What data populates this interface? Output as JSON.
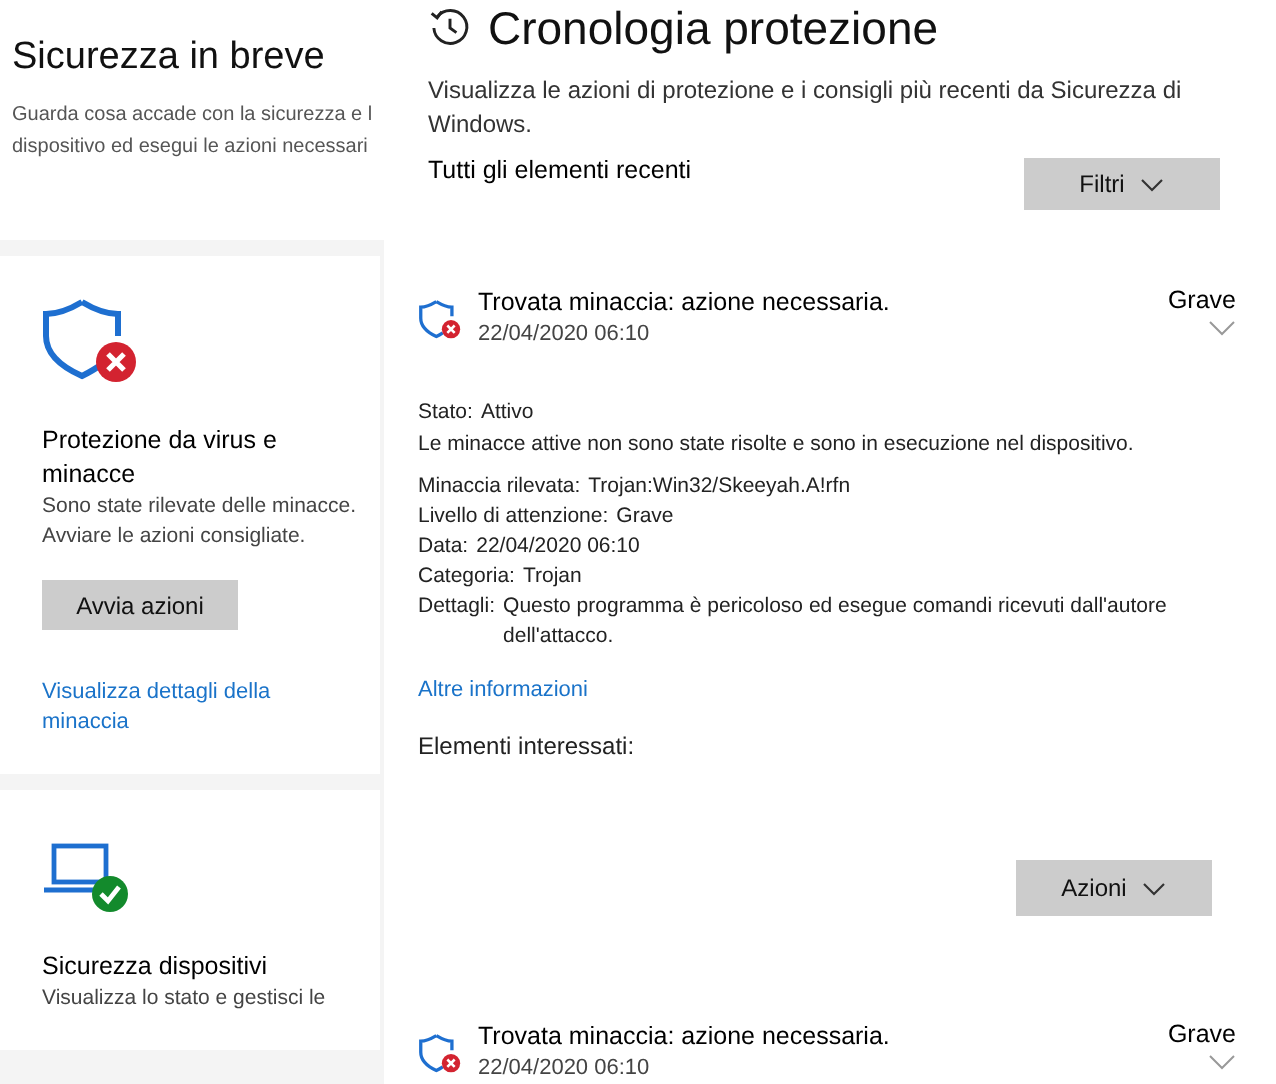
{
  "left_panel": {
    "title": "Sicurezza in breve",
    "description_lines": [
      "Guarda cosa accade con la sicurezza e l",
      "dispositivo ed esegui le azioni necessari"
    ],
    "cards": [
      {
        "kind": "virus",
        "warning": true,
        "title": "Protezione da virus e minacce",
        "text": "Sono state rilevate delle minacce. Avviare le azioni consigliate.",
        "button": "Avvia azioni",
        "link": "Visualizza dettagli della minaccia"
      },
      {
        "kind": "device",
        "warning": false,
        "title": "Sicurezza dispositivi",
        "text": "Visualizza lo stato e gestisci le"
      }
    ]
  },
  "main": {
    "title": "Cronologia protezione",
    "description": "Visualizza le azioni di protezione e i consigli più recenti da Sicurezza di Windows.",
    "section_label": "Tutti gli elementi recenti",
    "filter_button": "Filtri",
    "entries": [
      {
        "title": "Trovata minaccia: azione necessaria.",
        "date": "22/04/2020 06:10",
        "severity": "Grave",
        "state_label": "Stato:",
        "state": "Attivo",
        "state_text": "Le minacce attive non sono state risolte e sono in esecuzione nel dispositivo.",
        "fields": [
          {
            "label": "Minaccia rilevata:",
            "value": "Trojan:Win32/Skeeyah.A!rfn"
          },
          {
            "label": "Livello di attenzione:",
            "value": "Grave"
          },
          {
            "label": "Data:",
            "value": "22/04/2020 06:10"
          },
          {
            "label": "Categoria:",
            "value": "Trojan"
          },
          {
            "label": "Dettagli:",
            "value": "Questo programma è pericoloso ed esegue comandi ricevuti dall'autore dell'attacco."
          }
        ],
        "link": "Altre informazioni",
        "affected_label": "Elementi interessati:",
        "actions_button": "Azioni"
      },
      {
        "title": "Trovata minaccia: azione necessaria.",
        "date": "22/04/2020 06:10",
        "severity": "Grave"
      }
    ]
  }
}
